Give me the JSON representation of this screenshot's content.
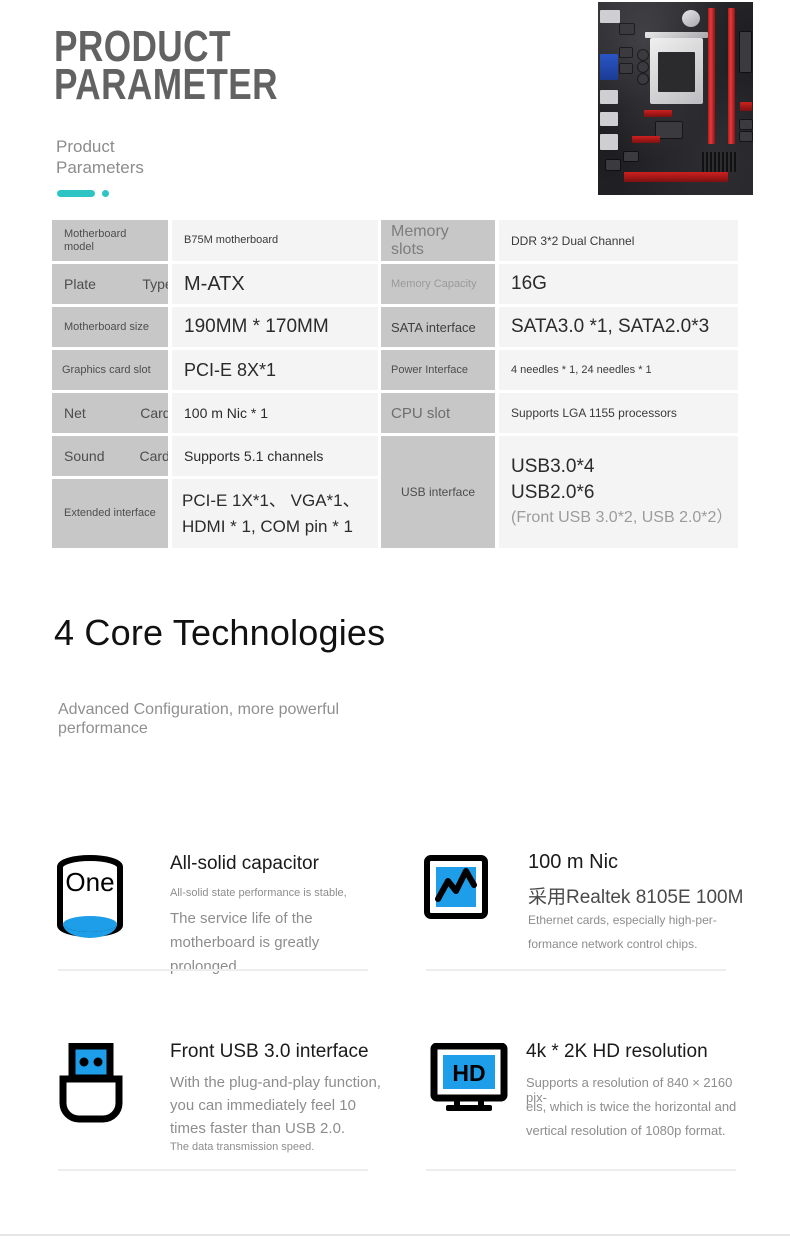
{
  "hero": {
    "title": "PRODUCT\nPARAMETER",
    "subtitle": "Product Parameters",
    "accent_color": "#2ec4c4",
    "product_image_alt": "b75m-motherboard-photo"
  },
  "spec_table": {
    "left": [
      {
        "label": "Motherboard model",
        "value": "B75M motherboard",
        "label_size": "small",
        "value_size": "small"
      },
      {
        "label": "Plate            Type",
        "value": "M-ATX",
        "label_size": "medium",
        "value_size": "large"
      },
      {
        "label": "Motherboard size",
        "value": "190MM * 170MM",
        "label_size": "small",
        "value_size": "large"
      },
      {
        "label": "Graphics card slot",
        "value": "PCI-E  8X*1",
        "label_size": "small",
        "value_size": "large"
      },
      {
        "label": "Net              Card",
        "value": "100 m Nic * 1",
        "label_size": "medium",
        "value_size": "medium"
      },
      {
        "label": "Sound         Card",
        "value": "Supports 5.1 channels",
        "label_size": "medium",
        "value_size": "medium"
      },
      {
        "label": "Extended interface",
        "value": "PCI-E 1X*1、 VGA*1、\nHDMI * 1, COM pin * 1",
        "label_size": "small",
        "value_size": "large"
      }
    ],
    "right": [
      {
        "label": "Memory slots",
        "value": "DDR 3*2 Dual Channel",
        "label_size": "large",
        "value_size": "small"
      },
      {
        "label": "Memory Capacity",
        "value": "16G",
        "label_size": "small",
        "value_size": "large"
      },
      {
        "label": "SATA interface",
        "value": "SATA3.0 *1, SATA2.0*3",
        "label_size": "medium",
        "value_size": "large"
      },
      {
        "label": "Power Interface",
        "value": "4 needles * 1, 24 needles * 1",
        "label_size": "small",
        "value_size": "small"
      },
      {
        "label": "CPU slot",
        "value": "Supports LGA 1155 processors",
        "label_size": "large",
        "value_size": "small"
      },
      {
        "label": "USB interface",
        "value_lines": [
          "USB3.0*4",
          "USB2.0*6",
          "(Front USB 3.0*2, USB 2.0*2）"
        ],
        "label_size": "small",
        "value_size": "large"
      }
    ]
  },
  "core_section": {
    "title": "4 Core Technologies",
    "subtitle": "Advanced Configuration, more powerful performance",
    "features": [
      {
        "icon": "capacitor-icon",
        "icon_label": "One",
        "title": "All-solid capacitor",
        "small_line": "All-solid state performance is stable,",
        "body": "The service life of the motherboard is greatly prolonged."
      },
      {
        "icon": "network-chart-icon",
        "title": "100 m Nic",
        "highlight": "采用Realtek 8105E 100M",
        "body_line1": "Ethernet cards, especially high-per-",
        "body_line2": "formance network control chips."
      },
      {
        "icon": "usb-flash-drive-icon",
        "title": "Front USB 3.0 interface",
        "body": "With the plug-and-play function, you can immediately feel 10 times faster than USB 2.0.",
        "small_line": "The data transmission speed."
      },
      {
        "icon": "hd-monitor-icon",
        "icon_label": "HD",
        "title": "4k * 2K HD resolution",
        "body_line1": "Supports a resolution of 840 × 2160 pix-",
        "body_line2": "els, which is twice the horizontal and",
        "body_line3": "vertical resolution of 1080p format."
      }
    ]
  },
  "colors": {
    "accent": "#2ec4c4",
    "label_cell": "#c7c7c7",
    "value_cell": "#f4f4f4",
    "icon_blue": "#1e9ee8",
    "rule": "#ededed"
  }
}
